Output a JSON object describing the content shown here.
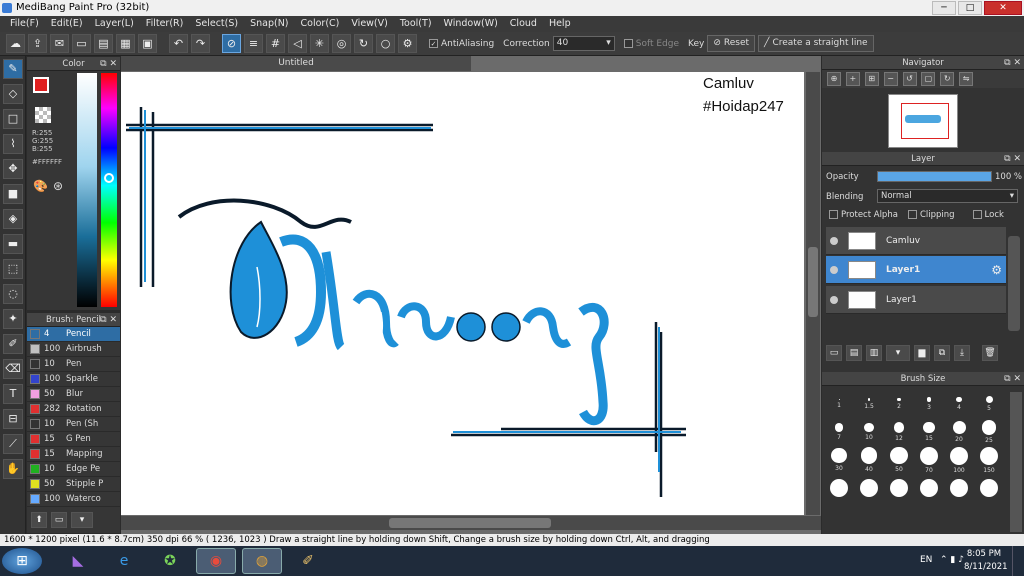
{
  "window": {
    "title": "MediBang Paint Pro (32bit)"
  },
  "menu": [
    "File(F)",
    "Edit(E)",
    "Layer(L)",
    "Filter(R)",
    "Select(S)",
    "Snap(N)",
    "Color(C)",
    "View(V)",
    "Tool(T)",
    "Window(W)",
    "Cloud",
    "Help"
  ],
  "toolbar": {
    "antialiasing_label": "AntiAliasing",
    "correction_label": "Correction",
    "correction_value": "40",
    "soft_edge_label": "Soft Edge",
    "key_label": "Key",
    "reset_label": "Reset",
    "straight_line_label": "Create a straight line"
  },
  "color_panel": {
    "title": "Color",
    "r": "R:255",
    "g": "G:255",
    "b": "B:255",
    "hex": "#FFFFFF",
    "primary_color": "#e02020",
    "secondary_color": "#ffffff"
  },
  "brush_panel": {
    "title": "Brush: Pencil",
    "items": [
      {
        "size": "4",
        "name": "Pencil",
        "color": "#2e6da4"
      },
      {
        "size": "100",
        "name": "Airbrush",
        "color": "#c0c0c0"
      },
      {
        "size": "10",
        "name": "Pen",
        "color": "#333333"
      },
      {
        "size": "100",
        "name": "Sparkle",
        "color": "#3344cc"
      },
      {
        "size": "50",
        "name": "Blur",
        "color": "#f0a0e0"
      },
      {
        "size": "282",
        "name": "Rotation",
        "color": "#e03030"
      },
      {
        "size": "10",
        "name": "Pen (Sh",
        "color": "#333333"
      },
      {
        "size": "15",
        "name": "G Pen",
        "color": "#e03030"
      },
      {
        "size": "15",
        "name": "Mapping",
        "color": "#e03030"
      },
      {
        "size": "10",
        "name": "Edge Pe",
        "color": "#20b020"
      },
      {
        "size": "50",
        "name": "Stipple P",
        "color": "#e0e020"
      },
      {
        "size": "100",
        "name": "Waterco",
        "color": "#66aaff"
      }
    ]
  },
  "document": {
    "tab_title": "Untitled",
    "annotation_line1": "Camluv",
    "annotation_line2": "#Hoidap247",
    "artwork_text": "Thương"
  },
  "navigator": {
    "title": "Navigator"
  },
  "layer_panel": {
    "title": "Layer",
    "opacity_label": "Opacity",
    "opacity_value": "100 %",
    "opacity_fraction": 1.0,
    "blending_label": "Blending",
    "blending_value": "Normal",
    "protect_alpha": "Protect Alpha",
    "clipping": "Clipping",
    "lock": "Lock",
    "layers": [
      {
        "name": "Camluv",
        "selected": false
      },
      {
        "name": "Layer1",
        "selected": true
      },
      {
        "name": "Layer1",
        "selected": false
      }
    ]
  },
  "brush_size_panel": {
    "title": "Brush Size",
    "sizes": [
      "1",
      "1.5",
      "2",
      "3",
      "4",
      "5",
      "7",
      "10",
      "12",
      "15",
      "20",
      "25",
      "30",
      "40",
      "50",
      "70",
      "100",
      "150"
    ]
  },
  "statusbar": {
    "text": "1600 * 1200 pixel   (11.6 * 8.7cm)   350 dpi   66 %   ( 1236, 1023 )   Draw a straight line by holding down Shift, Change a brush size by holding down Ctrl, Alt, and dragging"
  },
  "taskbar": {
    "language": "EN",
    "time": "8:05 PM",
    "date": "8/11/2021"
  },
  "colors": {
    "accent": "#3f86cf",
    "ink": "#1e90d8",
    "outline": "#0a1a2a"
  }
}
